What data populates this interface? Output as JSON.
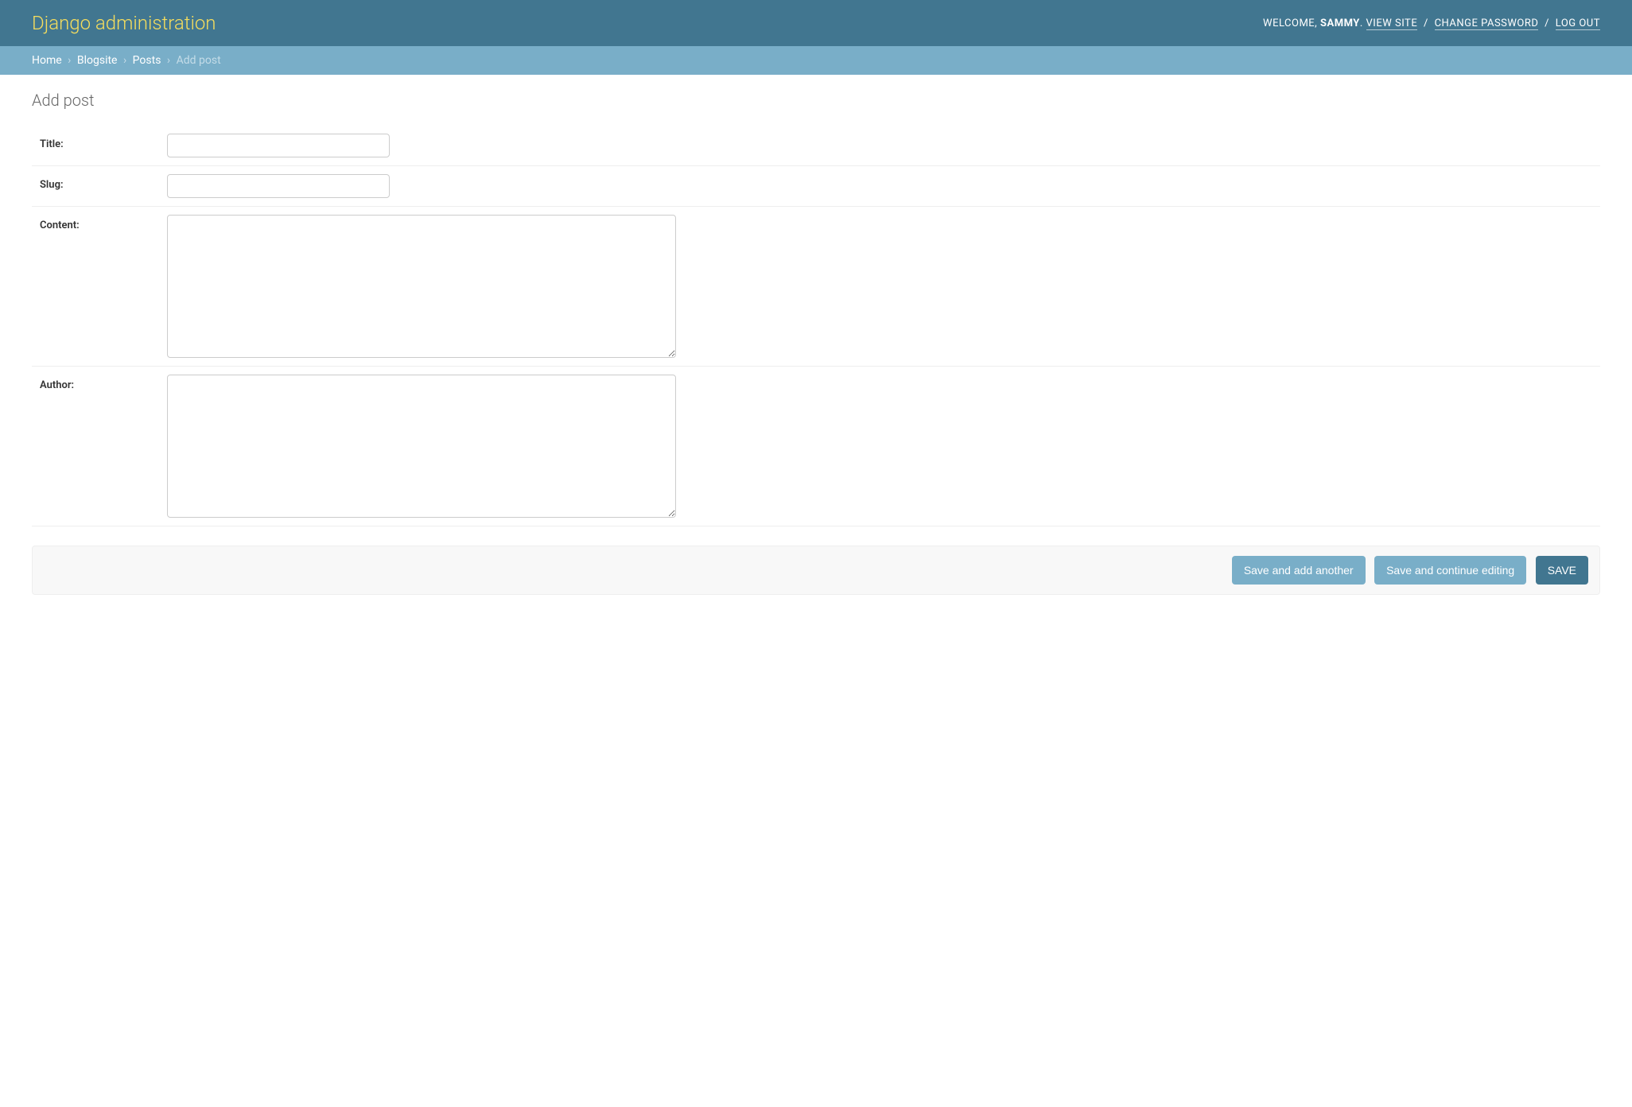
{
  "header": {
    "site_title": "Django administration",
    "welcome_prefix": "Welcome,",
    "username": "Sammy",
    "view_site": "View site",
    "change_password": "Change password",
    "log_out": "Log out"
  },
  "breadcrumbs": {
    "home": "Home",
    "app": "Blogsite",
    "model": "Posts",
    "current": "Add post"
  },
  "page": {
    "title": "Add post"
  },
  "fields": {
    "title": {
      "label": "Title:",
      "value": ""
    },
    "slug": {
      "label": "Slug:",
      "value": ""
    },
    "content": {
      "label": "Content:",
      "value": ""
    },
    "author": {
      "label": "Author:",
      "value": ""
    }
  },
  "buttons": {
    "save_add_another": "Save and add another",
    "save_continue": "Save and continue editing",
    "save": "SAVE"
  }
}
